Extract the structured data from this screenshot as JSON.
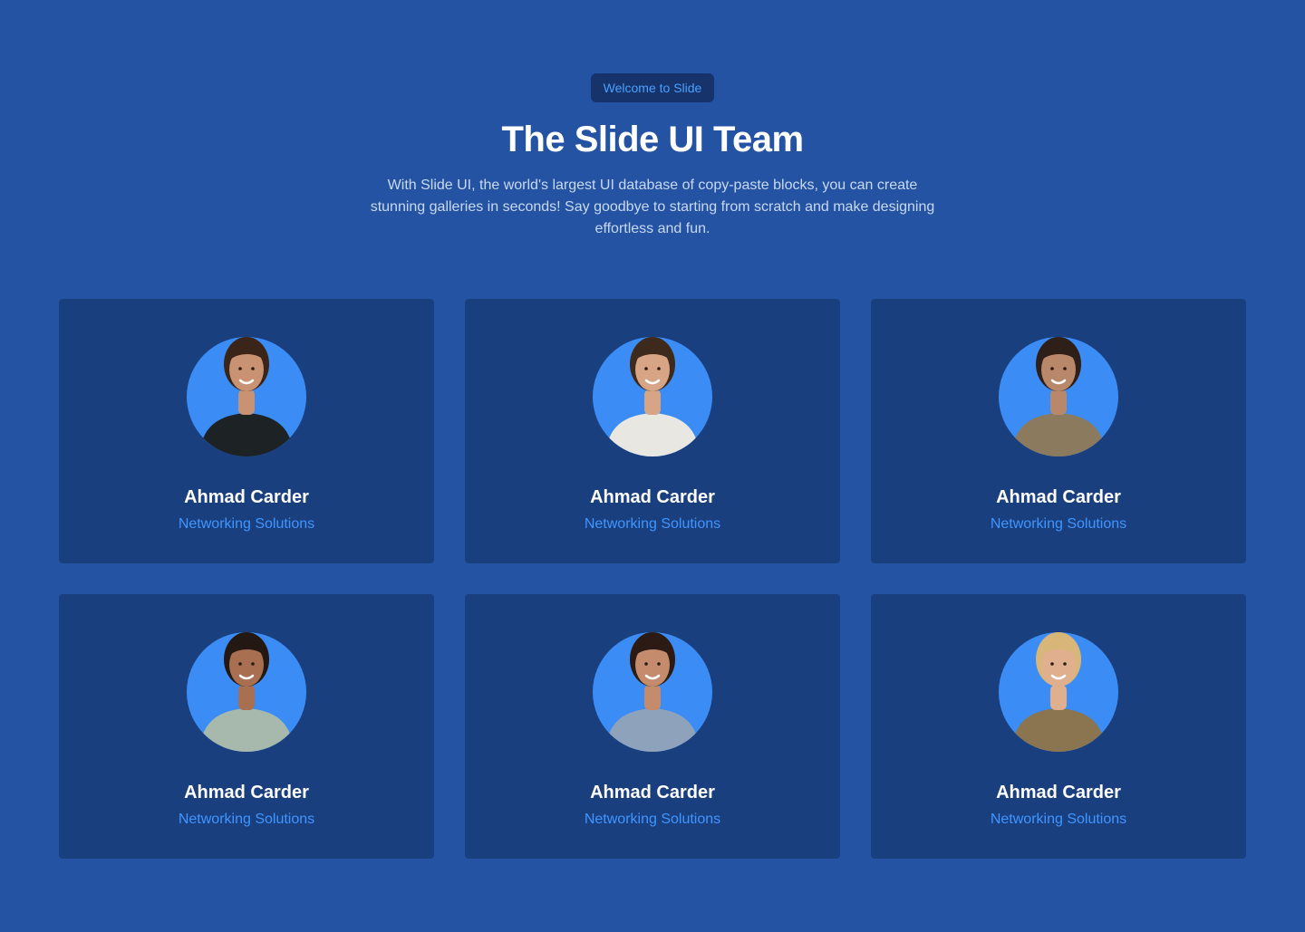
{
  "hero": {
    "badge": "Welcome to Slide",
    "title": "The Slide UI Team",
    "subtitle": "With Slide UI, the world's largest UI database of copy-paste blocks, you can create stunning galleries in seconds! Say goodbye to starting from scratch and make designing effortless and fun."
  },
  "team": [
    {
      "name": "Ahmad Carder",
      "role": "Networking Solutions",
      "avatar": "woman-dark-shirt",
      "skin": "#c99272",
      "hair": "#3b2418",
      "outfit": "#1d2224"
    },
    {
      "name": "Ahmad Carder",
      "role": "Networking Solutions",
      "avatar": "man-glasses-laptop",
      "skin": "#d7a585",
      "hair": "#3e2a1d",
      "outfit": "#e8e7e2"
    },
    {
      "name": "Ahmad Carder",
      "role": "Networking Solutions",
      "avatar": "man-jacket-laptop",
      "skin": "#b9876a",
      "hair": "#2e2019",
      "outfit": "#8b7a5e"
    },
    {
      "name": "Ahmad Carder",
      "role": "Networking Solutions",
      "avatar": "woman-floral-shirt",
      "skin": "#a86f50",
      "hair": "#231812",
      "outfit": "#a7b9ad"
    },
    {
      "name": "Ahmad Carder",
      "role": "Networking Solutions",
      "avatar": "woman-glasses-blouse",
      "skin": "#c48c6d",
      "hair": "#2b1b14",
      "outfit": "#8fa2bb"
    },
    {
      "name": "Ahmad Carder",
      "role": "Networking Solutions",
      "avatar": "woman-camera",
      "skin": "#e0b08e",
      "hair": "#d8b67a",
      "outfit": "#8a7550"
    }
  ],
  "colors": {
    "page_bg": "#2353a2",
    "card_bg": "#1a3f7f",
    "accent": "#3f96ff",
    "avatar_circle": "#3b8df5"
  }
}
